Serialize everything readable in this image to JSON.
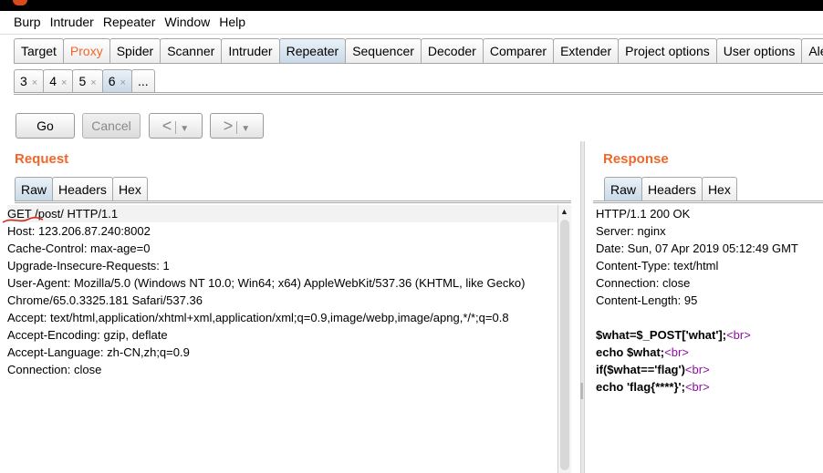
{
  "menu": [
    "Burp",
    "Intruder",
    "Repeater",
    "Window",
    "Help"
  ],
  "main_tabs": [
    "Target",
    "Proxy",
    "Spider",
    "Scanner",
    "Intruder",
    "Repeater",
    "Sequencer",
    "Decoder",
    "Comparer",
    "Extender",
    "Project options",
    "User options",
    "Alerts"
  ],
  "sub_tabs": [
    "3",
    "4",
    "5",
    "6",
    "..."
  ],
  "close_glyph": "×",
  "toolbar": {
    "go": "Go",
    "cancel": "Cancel",
    "back": "<",
    "forward": ">",
    "drop": "▼"
  },
  "request": {
    "title": "Request",
    "tabs": [
      "Raw",
      "Headers",
      "Hex"
    ],
    "lines": [
      "GET /post/ HTTP/1.1",
      "Host: 123.206.87.240:8002",
      "Cache-Control: max-age=0",
      "Upgrade-Insecure-Requests: 1",
      "User-Agent: Mozilla/5.0 (Windows NT 10.0; Win64; x64) AppleWebKit/537.36 (KHTML, like Gecko)",
      "Chrome/65.0.3325.181 Safari/537.36",
      "Accept: text/html,application/xhtml+xml,application/xml;q=0.9,image/webp,image/apng,*/*;q=0.8",
      "Accept-Encoding: gzip, deflate",
      "Accept-Language: zh-CN,zh;q=0.9",
      "Connection: close"
    ]
  },
  "response": {
    "title": "Response",
    "tabs": [
      "Raw",
      "Headers",
      "Hex"
    ],
    "header_lines": [
      "HTTP/1.1 200 OK",
      "Server: nginx",
      "Date: Sun, 07 Apr 2019 05:12:49 GMT",
      "Content-Type: text/html",
      "Connection: close",
      "Content-Length: 95"
    ],
    "body_lines": [
      {
        "code": "$what=$_POST['what'];",
        "tag": "<br>"
      },
      {
        "code": "echo $what;",
        "tag": "<br>"
      },
      {
        "code": "if($what=='flag')",
        "tag": "<br>"
      },
      {
        "code": "echo 'flag{****}';",
        "tag": "<br>"
      }
    ]
  },
  "colors": {
    "accent": "#f0672a",
    "tag": "#8a0f9e",
    "active_tab": "#c9d9e8"
  }
}
